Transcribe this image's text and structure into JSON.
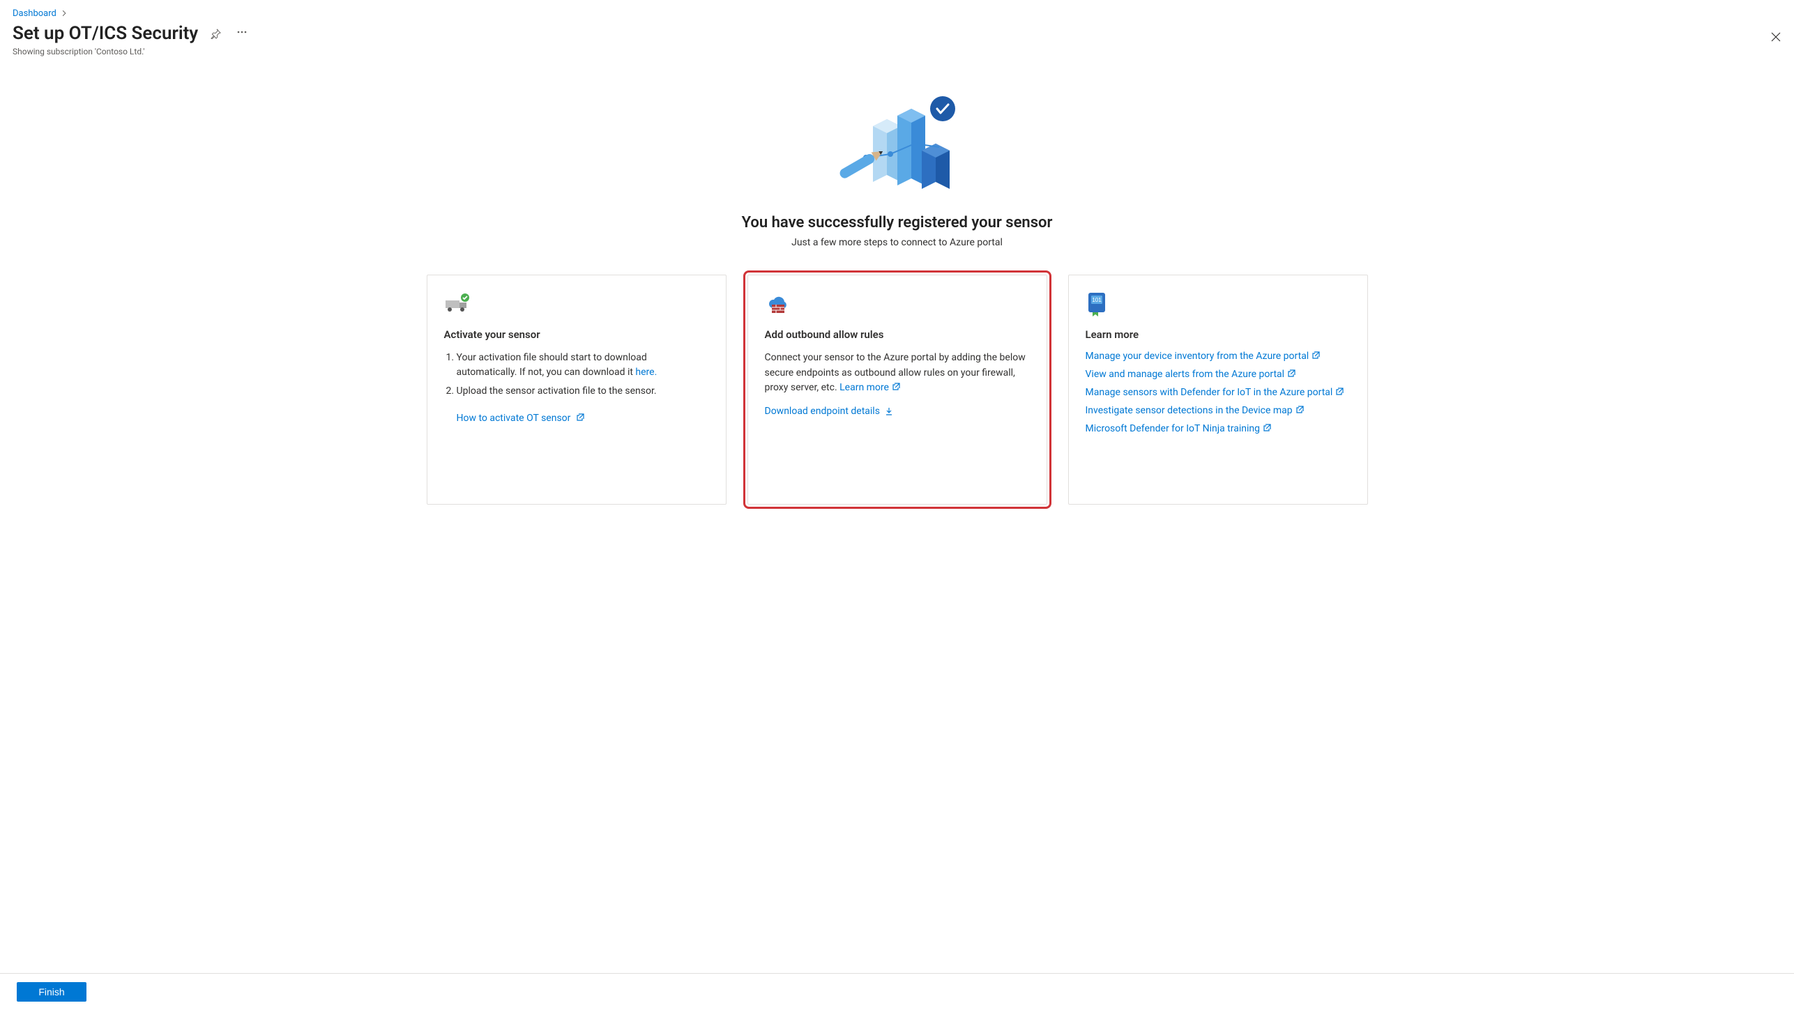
{
  "breadcrumb": {
    "item": "Dashboard"
  },
  "header": {
    "title": "Set up OT/ICS Security",
    "subtitle": "Showing subscription 'Contoso Ltd.'"
  },
  "hero": {
    "title": "You have successfully registered your sensor",
    "subtitle": "Just a few more steps to connect to Azure portal"
  },
  "cards": {
    "activate": {
      "title": "Activate your sensor",
      "step1_pre": "Your activation file should start to download automatically. If not, you can download it ",
      "step1_link": "here.",
      "step2": "Upload the sensor activation file to the sensor.",
      "howto": "How to activate OT sensor"
    },
    "outbound": {
      "title": "Add outbound allow rules",
      "desc": "Connect your sensor to the Azure portal by adding the below secure endpoints as outbound allow rules on your firewall, proxy server, etc. ",
      "learn_more": "Learn more",
      "download": "Download endpoint details"
    },
    "learn": {
      "title": "Learn more",
      "links": [
        "Manage your device inventory from the Azure portal",
        "View and manage alerts from the Azure portal",
        "Manage sensors with Defender for IoT in the Azure portal",
        "Investigate sensor detections in the Device map",
        "Microsoft Defender for IoT Ninja training"
      ]
    }
  },
  "footer": {
    "finish": "Finish"
  }
}
